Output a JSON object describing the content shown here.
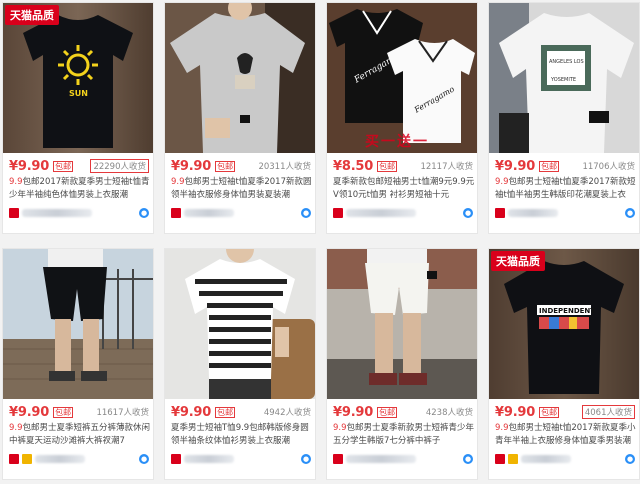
{
  "badge_label": "天猫品质",
  "baoyou_label": "包邮",
  "shop_icon": "shop-icon",
  "wangwang_icon": "wangwang-chat-icon",
  "colors": {
    "price": "#e4393c",
    "badge": "#d9001b",
    "wangwang": "#2a8ff7"
  },
  "products": [
    {
      "price": "¥9.90",
      "sales": "22290人收货",
      "title_hl": "9.9",
      "title": "包邮2017新款夏季男士短袖t恤青少年半袖纯色体恤男装上衣服潮",
      "badge": true,
      "sales_boxed": true
    },
    {
      "price": "¥9.90",
      "sales": "20311人收货",
      "title_hl": "9.9",
      "title": "包邮男士短袖t恤夏季2017新款圆领半袖衣服修身体恤男装夏装潮",
      "badge": false,
      "sales_boxed": false
    },
    {
      "price": "¥8.50",
      "sales": "12117人收货",
      "title_hl": "",
      "title": "夏季新款包邮短袖男士t恤潮9元9.9元V领10元t恤男 衬衫男短袖十元",
      "badge": false,
      "sales_boxed": false,
      "overlay": "买一送一"
    },
    {
      "price": "¥9.90",
      "sales": "11706人收货",
      "title_hl": "9.9",
      "title": "包邮男士短袖t恤夏季2017新款短袖t恤半袖男生韩版印花潮夏装上衣",
      "badge": false,
      "sales_boxed": false
    },
    {
      "price": "¥9.90",
      "sales": "11617人收货",
      "title_hl": "9.9",
      "title": "包邮男士夏季短裤五分裤薄款休闲中裤夏天运动沙滩裤大裤衩潮7",
      "badge": false,
      "sales_boxed": false
    },
    {
      "price": "¥9.90",
      "sales": "4942人收货",
      "title_hl": "",
      "title": "夏季男士短袖T恤9.9包邮韩版修身圆领半袖条纹体恤衫男装上衣服潮",
      "badge": false,
      "sales_boxed": false
    },
    {
      "price": "¥9.90",
      "sales": "4238人收货",
      "title_hl": "9.9",
      "title": "包邮男士夏季新款男士短裤青少年五分学生韩版7七分裤中裤子",
      "badge": false,
      "sales_boxed": false
    },
    {
      "price": "¥9.90",
      "sales": "4061人收货",
      "title_hl": "9.9",
      "title": "包邮男士短袖t恤2017新款夏季小青年半袖上衣服修身体恤夏季男装潮",
      "badge": true,
      "sales_boxed": true
    }
  ]
}
